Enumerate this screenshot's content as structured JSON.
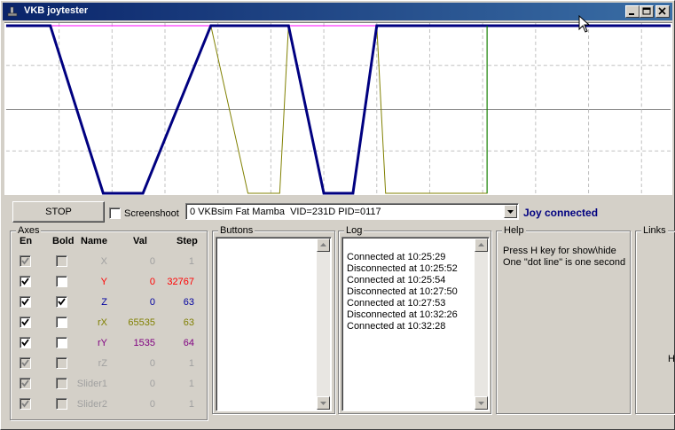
{
  "window": {
    "title": "VKB joytester"
  },
  "controls": {
    "stop_label": "STOP",
    "screenshot_label": "Screenshoot",
    "device_value": "0 VKBsim Fat Mamba  VID=231D PID=0117",
    "status": "Joy connected",
    "status_color": "#000080"
  },
  "axes": {
    "title": "Axes",
    "columns": {
      "en": "En",
      "bold": "Bold",
      "name": "Name",
      "val": "Val",
      "step": "Step"
    },
    "rows": [
      {
        "name": "X",
        "val": "0",
        "step": "1",
        "en": true,
        "bold": false,
        "active": false,
        "color": "#a0a0a0"
      },
      {
        "name": "Y",
        "val": "0",
        "step": "32767",
        "en": true,
        "bold": false,
        "active": true,
        "color": "#ff0000"
      },
      {
        "name": "Z",
        "val": "0",
        "step": "63",
        "en": true,
        "bold": true,
        "active": true,
        "color": "#0000a0"
      },
      {
        "name": "rX",
        "val": "65535",
        "step": "63",
        "en": true,
        "bold": false,
        "active": true,
        "color": "#808000"
      },
      {
        "name": "rY",
        "val": "1535",
        "step": "64",
        "en": true,
        "bold": false,
        "active": true,
        "color": "#800080"
      },
      {
        "name": "rZ",
        "val": "0",
        "step": "1",
        "en": true,
        "bold": false,
        "active": false,
        "color": "#a0a0a0"
      },
      {
        "name": "Slider1",
        "val": "0",
        "step": "1",
        "en": true,
        "bold": false,
        "active": false,
        "color": "#a0a0a0"
      },
      {
        "name": "Slider2",
        "val": "0",
        "step": "1",
        "en": true,
        "bold": false,
        "active": false,
        "color": "#a0a0a0"
      }
    ]
  },
  "buttons_panel": {
    "title": "Buttons"
  },
  "log": {
    "title": "Log",
    "lines": [
      "Connected at 10:25:29",
      "Disconnected at 10:25:52",
      "Connected at 10:25:54",
      "Disconnected at 10:27:50",
      "Connected at 10:27:53",
      "Disconnected at 10:32:26",
      "Connected at 10:32:28"
    ]
  },
  "help": {
    "title": "Help",
    "lines": [
      "Press H key for show\\hide",
      "One \"dot line\" is one second"
    ]
  },
  "links": {
    "title": "Links",
    "edge_char": "H"
  },
  "graph": {
    "series_colors": {
      "z": "#000080",
      "rx": "#808000",
      "ry": "#ff00ff",
      "marker": "#008000"
    },
    "icon_names": [
      "app-icon",
      "minimize-icon",
      "maximize-icon",
      "close-icon",
      "dropdown-arrow-icon",
      "scroll-up-icon",
      "scroll-down-icon",
      "mouse-cursor-icon"
    ]
  }
}
